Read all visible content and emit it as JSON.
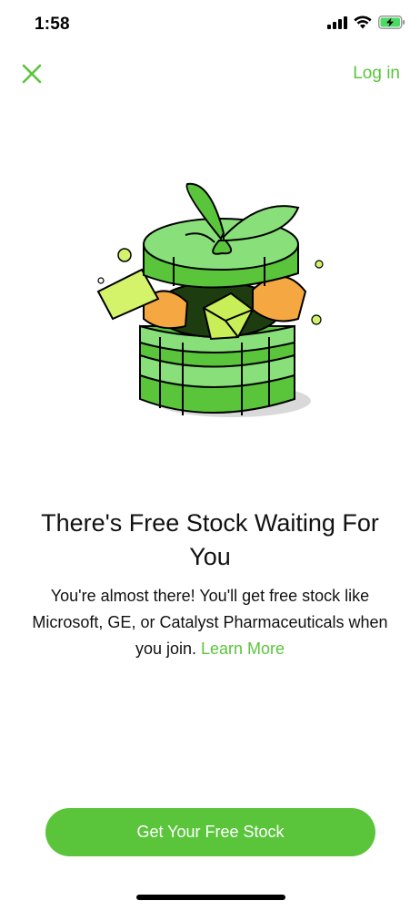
{
  "status_bar": {
    "time": "1:58"
  },
  "nav": {
    "close_icon": "close-icon",
    "login_label": "Log in"
  },
  "hero": {
    "illustration": "gift-box-with-stocks"
  },
  "content": {
    "headline": "There's Free Stock Waiting For You",
    "body": "You're almost there! You'll get free stock like Microsoft, GE, or Catalyst Pharmaceuticals when you join.",
    "learn_more_label": "Learn More"
  },
  "cta": {
    "label": "Get Your Free Stock"
  },
  "colors": {
    "accent": "#5ac53b",
    "button_text": "#ffffff",
    "text": "#111111"
  }
}
